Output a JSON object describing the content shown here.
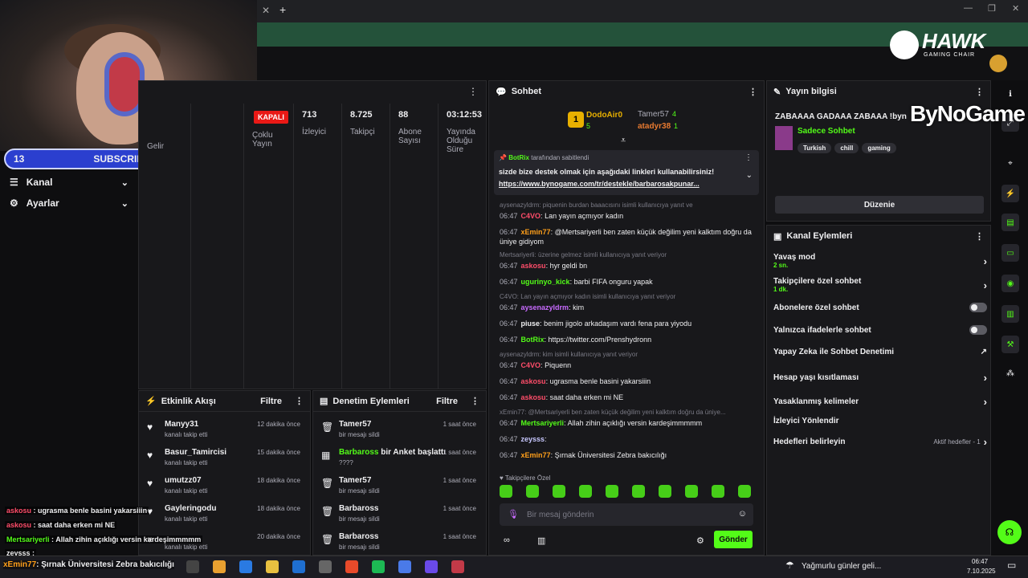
{
  "brand": {
    "hawk": "HAWK",
    "hawk_sub": "GAMING CHAIR",
    "bynogame": "ByNoGame"
  },
  "overlay": {
    "sub_left": "13",
    "sub_label": "SUBSCRIBERS",
    "sub_right": "10"
  },
  "nav": {
    "kanal": "Kanal",
    "ayarlar": "Ayarlar"
  },
  "stats": {
    "kapali": "KAPALI",
    "gelir": "Gelir",
    "coklu": "Çoklu Yayın",
    "items": [
      {
        "value": "713",
        "label": "İzleyici"
      },
      {
        "value": "8.725",
        "label": "Takipçi"
      },
      {
        "value": "88",
        "label": "Abone Sayısı"
      },
      {
        "value": "03:12:53",
        "label": "Yayında Olduğu Süre"
      }
    ]
  },
  "activity": {
    "title": "Etkinlik Akışı",
    "filter": "Filtre",
    "items": [
      {
        "name": "Manyy31",
        "sub": "kanalı takip etti",
        "time": "12 dakika önce"
      },
      {
        "name": "Basur_Tamircisi",
        "sub": "kanalı takip etti",
        "time": "15 dakika önce"
      },
      {
        "name": "umutzz07",
        "sub": "kanalı takip etti",
        "time": "18 dakika önce"
      },
      {
        "name": "Gayleringodu",
        "sub": "kanalı takip etti",
        "time": "18 dakika önce"
      },
      {
        "name": "",
        "sub": "kanalı takip etti",
        "time": "20 dakika önce"
      }
    ]
  },
  "moderation": {
    "title": "Denetim Eylemleri",
    "filter": "Filtre",
    "items": [
      {
        "name": "Tamer57",
        "sub": "bir mesajı sildi",
        "time": "1 saat önce"
      },
      {
        "name": "Barbaross",
        "extra": " bir Anket başlattı",
        "sub": "????",
        "time": "1 saat önce"
      },
      {
        "name": "Tamer57",
        "sub": "bir mesajı sildi",
        "time": "1 saat önce"
      },
      {
        "name": "Barbaross",
        "sub": "bir mesajı sildi",
        "time": "1 saat önce"
      },
      {
        "name": "Barbaross",
        "sub": "bir mesajı sildi",
        "time": "1 saat önce"
      }
    ]
  },
  "chat": {
    "title": "Sohbet",
    "leaders": {
      "first": "DodoAir0",
      "first_count": "5",
      "second": "Tamer57",
      "second_count": "4",
      "third": "atadyr38",
      "third_count": "1"
    },
    "pinned": {
      "by": "BotRix",
      "by_suffix": "tarafından sabitlendi",
      "text": "sizde bize destek olmak için aşağıdaki linkleri kullanabilirsiniz!",
      "link": "https://www.bynogame.com/tr/destekle/barbarosakpunar..."
    },
    "messages": [
      {
        "reply": "aysenazyldrm: piquenin burdan baaacısını isimli kullanıcıya yanıt ve",
        "time": "06:47",
        "user": "C4VO",
        "color": "#ff4d6a",
        "text": "Lan yayın açmıyor kadın"
      },
      {
        "time": "06:47",
        "user": "xEmin77",
        "color": "#ff9f1a",
        "text": "@Mertsariyerli ben zaten küçük değilim yeni kalktım doğru da üniye gidiyom"
      },
      {
        "reply": "Mertsariyerli: üzerine gelmez isimli kullanıcıya yanıt veriyor",
        "time": "06:47",
        "user": "askosu",
        "color": "#ff4d6a",
        "text": "hyr geldi bn"
      },
      {
        "time": "06:47",
        "user": "ugurinyo_kick",
        "color": "#53fc18",
        "text": "barbi FIFA onguru yapak"
      },
      {
        "reply": "C4VO: Lan yayın açmıyor kadın isimli kullanıcıya yanıt veriyor",
        "time": "06:47",
        "user": "aysenazyldrm",
        "color": "#c86bff",
        "text": "kim"
      },
      {
        "time": "06:47",
        "user": "piuse",
        "color": "#efeff1",
        "text": "benim jigolo arkadaşım vardı fena para yiyodu"
      },
      {
        "time": "06:47",
        "user": "BotRix",
        "color": "#53fc18",
        "text": "https://twitter.com/Prenshydronn"
      },
      {
        "reply": "aysenazyldrm: kim isimli kullanıcıya yanıt veriyor",
        "time": "06:47",
        "user": "C4VO",
        "color": "#ff4d6a",
        "text": "Piquenn"
      },
      {
        "time": "06:47",
        "user": "askosu",
        "color": "#ff4d6a",
        "text": "ugrasma benle basini yakarsiiin"
      },
      {
        "time": "06:47",
        "user": "askosu",
        "color": "#ff4d6a",
        "text": "saat daha erken mi NE"
      },
      {
        "reply": "xEmin77: @Mertsariyerli ben zaten küçük değilim yeni kalktım doğru da üniye...",
        "time": "06:47",
        "user": "Mertsariyerli",
        "color": "#53fc18",
        "text": "Allah zihin açıklığı versin kardeşimmmmm"
      },
      {
        "time": "06:47",
        "user": "zeysss",
        "color": "#c8c8ff",
        "text": ""
      },
      {
        "time": "06:47",
        "user": "xEmin77",
        "color": "#ff9f1a",
        "text": "Şırnak Üniversitesi Zebra bakıcılığı"
      }
    ],
    "emote_label": "Takipçilere Özel",
    "input_placeholder": "Bir mesaj gönderin",
    "send": "Gönder"
  },
  "stream_info": {
    "title": "Yayın bilgisi",
    "stream_title": "ZABAAAA GADAAA ZABAAA !byn",
    "category": "Sadece Sohbet",
    "tags": [
      "Turkish",
      "chill",
      "gaming"
    ],
    "edit": "Düzenie"
  },
  "channel_actions": {
    "title": "Kanal Eylemleri",
    "rows": [
      {
        "label": "Yavaş mod",
        "sub": "2 sn.",
        "type": "arrow"
      },
      {
        "label": "Takipçilere özel sohbet",
        "sub": "1 dk.",
        "type": "arrow"
      },
      {
        "label": "Abonelere özel sohbet",
        "type": "toggle"
      },
      {
        "label": "Yalnızca ifadelerle sohbet",
        "type": "toggle"
      },
      {
        "label": "Yapay Zeka ile Sohbet Denetimi",
        "type": "ext"
      },
      {
        "label": "Hesap yaşı kısıtlaması",
        "type": "arrow"
      },
      {
        "label": "Yasaklanmış kelimeler",
        "type": "arrow"
      },
      {
        "label": "İzleyici Yönlendir",
        "type": "none"
      },
      {
        "label": "Hedefleri belirleyin",
        "right": "Aktif hedefler - 1",
        "type": "arrow"
      }
    ]
  },
  "overlay_chat": [
    {
      "user": "askosu",
      "color": "#ff4d6a",
      "text": "ugrasma benle basini yakarsiiin"
    },
    {
      "user": "askosu",
      "color": "#ff4d6a",
      "text": "saat daha erken mi NE"
    },
    {
      "user": "Mertsariyerli",
      "color": "#53fc18",
      "text": "Allah zihin açıklığı versin kardeşimmmmm"
    },
    {
      "user": "zeysss",
      "color": "#efeff1",
      "text": ""
    },
    {
      "user": "xEmin77",
      "color": "#ff9f1a",
      "text": "Şırnak Üniversitesi Zebra bakıcılığı"
    }
  ],
  "taskbar": {
    "weather": "Yağmurlu günler geli...",
    "time": "06:47",
    "date": "7.10.2025"
  },
  "colors": {
    "accent": "#53fc18",
    "kick_green": "#53fc18",
    "danger": "#e91916"
  }
}
